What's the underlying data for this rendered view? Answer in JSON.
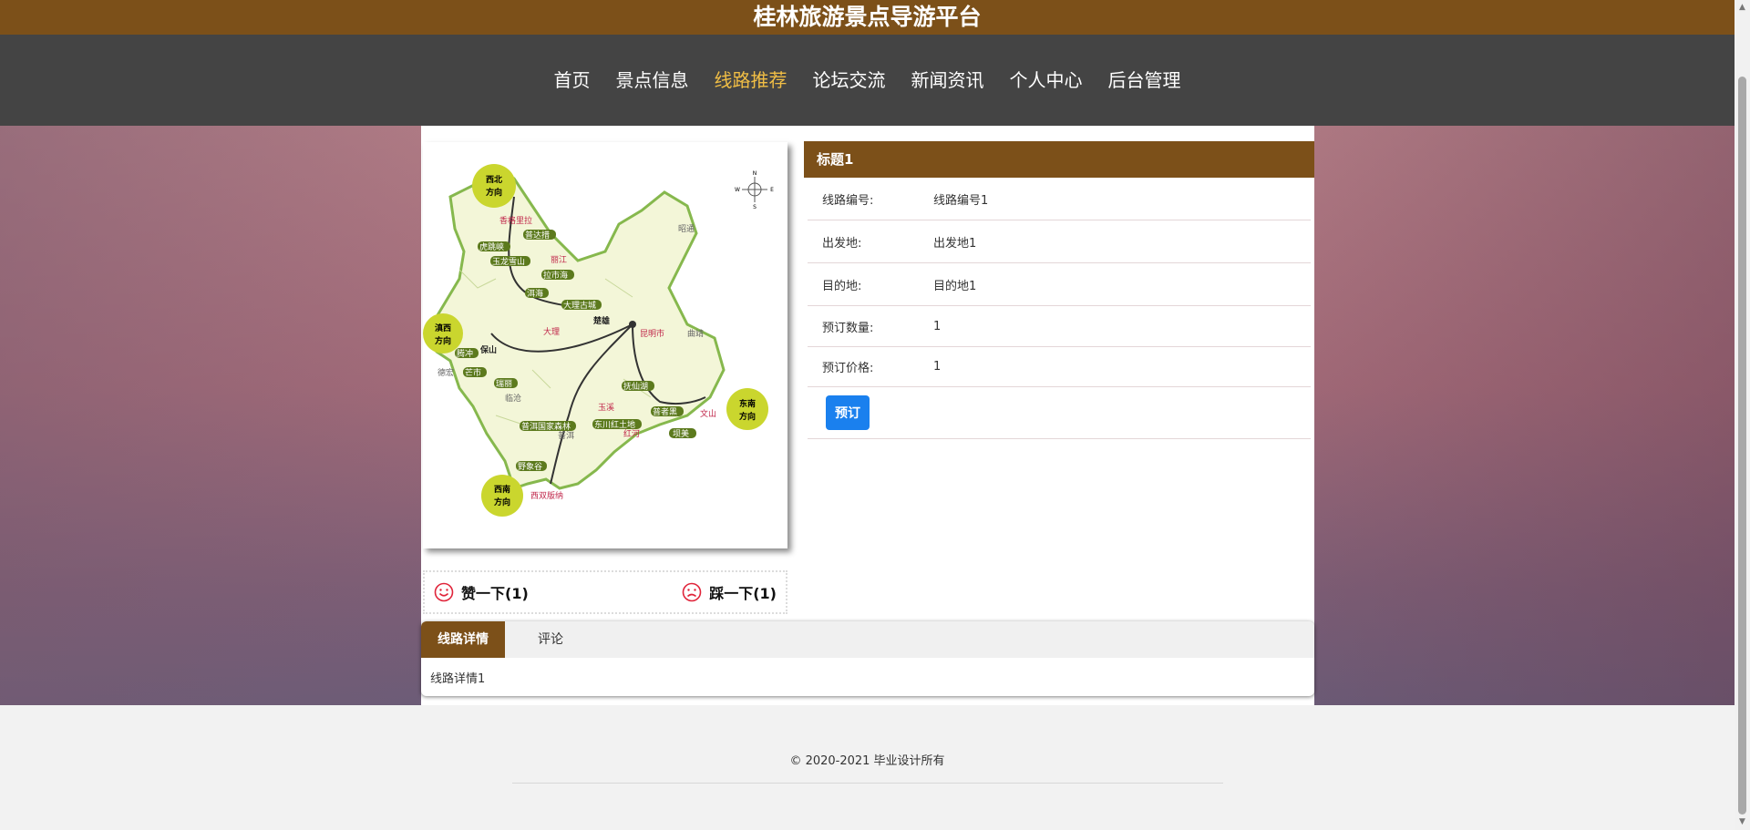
{
  "site_title": "桂林旅游景点导游平台",
  "nav": {
    "items": [
      "首页",
      "景点信息",
      "线路推荐",
      "论坛交流",
      "新闻资讯",
      "个人中心",
      "后台管理"
    ],
    "active_index": 2,
    "active_color": "#f1be45"
  },
  "map": {
    "region_labels": {
      "nw": [
        "西北",
        "方向"
      ],
      "w": [
        "滇西",
        "方向"
      ],
      "sw": [
        "西南",
        "方向"
      ],
      "se": [
        "东南",
        "方向"
      ]
    },
    "compass": {
      "n": "N",
      "s": "S",
      "e": "E",
      "w": "W"
    },
    "places": [
      "香格里拉",
      "普达措",
      "虎跳峡",
      "丽江",
      "玉龙雪山",
      "拉市海",
      "洱海",
      "大理古城",
      "大理",
      "楚雄",
      "昭通",
      "昆明市",
      "曲靖",
      "腾冲",
      "保山",
      "芒市",
      "德宏",
      "瑞丽",
      "抚仙湖",
      "玉溪",
      "临沧",
      "普者黑",
      "文山",
      "普洱国家森林",
      "东川红土地",
      "普洱",
      "红河",
      "坝美",
      "野象谷",
      "西双版纳"
    ]
  },
  "votes": {
    "like": "赞一下(1)",
    "dislike": "踩一下(1)"
  },
  "detail": {
    "title": "标题1",
    "rows": [
      {
        "label": "线路编号:",
        "value": "线路编号1"
      },
      {
        "label": "出发地:",
        "value": "出发地1"
      },
      {
        "label": "目的地:",
        "value": "目的地1"
      },
      {
        "label": "预订数量:",
        "value": "1"
      },
      {
        "label": "预订价格:",
        "value": "1"
      }
    ],
    "book_label": "预订",
    "book_color": "#1a80ee"
  },
  "tabs": {
    "items": [
      "线路详情",
      "评论"
    ],
    "active_index": 0,
    "body": "线路详情1"
  },
  "footer": {
    "copyright": "© 2020-2021 毕业设计所有"
  },
  "colors": {
    "brand": "#7c5019",
    "nav_bg": "#444444"
  }
}
